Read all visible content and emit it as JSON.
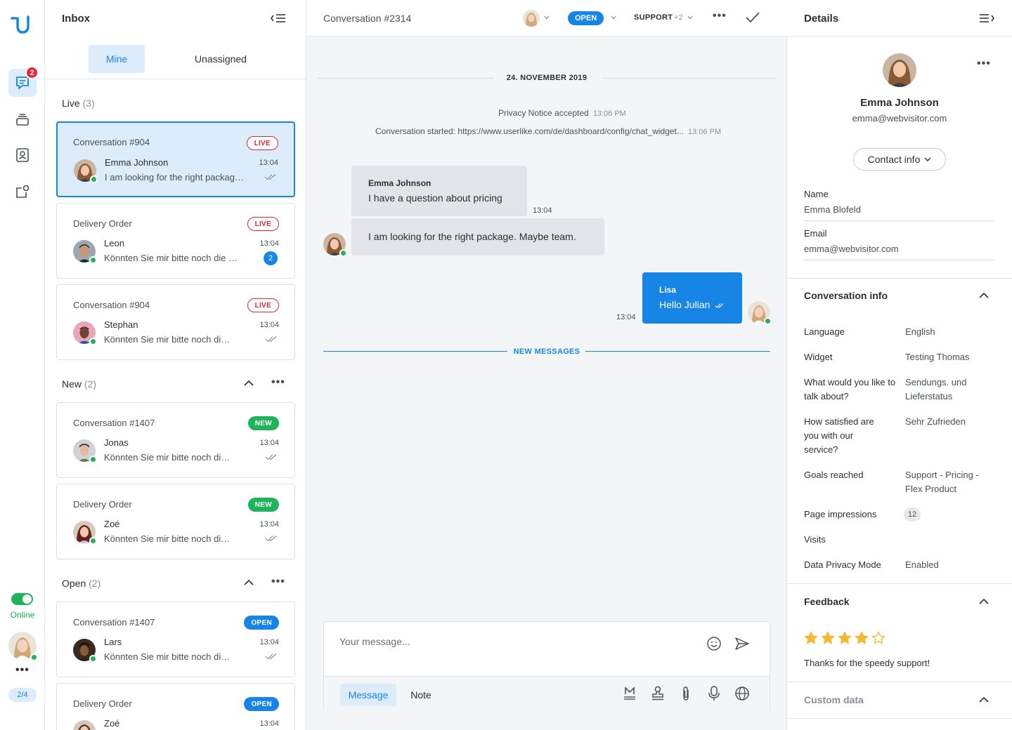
{
  "colors": {
    "accent": "#1785e6",
    "accent_light": "#dcecfb",
    "live": "#e52833",
    "success": "#1fb35b",
    "star": "#f5b82e"
  },
  "rail": {
    "logo": "userlike-logo",
    "items": [
      {
        "icon": "chat-icon",
        "active": true,
        "badge": "2"
      },
      {
        "icon": "stack-icon"
      },
      {
        "icon": "contacts-icon"
      },
      {
        "icon": "widget-icon"
      }
    ],
    "status": "Online",
    "page_indicator": "2/4"
  },
  "inbox": {
    "title": "Inbox",
    "tabs": {
      "mine": "Mine",
      "unassigned": "Unassigned"
    },
    "sections": {
      "live": {
        "label": "Live",
        "count": "(3)"
      },
      "new": {
        "label": "New",
        "count": "(2)"
      },
      "open": {
        "label": "Open",
        "count": "(2)"
      }
    },
    "cards": [
      {
        "title": "Conversation #904",
        "status": "LIVE",
        "name": "Emma Johnson",
        "message": "I am looking for the right package. Maybe team.",
        "time": "13:04"
      },
      {
        "title": "Delivery Order",
        "status": "LIVE",
        "name": "Leon",
        "message": "Könnten Sie mir bitte noch die Lieferzeit sagen?",
        "time": "13:04",
        "unread": "2"
      },
      {
        "title": "Conversation #904",
        "status": "LIVE",
        "name": "Stephan",
        "message": "Könnten Sie mir bitte noch die Lieferzeit sagen?",
        "time": "13:04"
      },
      {
        "title": "Conversation #1407",
        "status": "NEW",
        "name": "Jonas",
        "message": "Könnten Sie mir bitte noch die Lieferzeit sagen?",
        "time": "13:04"
      },
      {
        "title": "Delivery Order",
        "status": "NEW",
        "name": "Zoé",
        "message": "Könnten Sie mir bitte noch die Lieferzeit sagen?",
        "time": "13:04"
      },
      {
        "title": "Conversation #1407",
        "status": "OPEN",
        "name": "Lars",
        "message": "Könnten Sie mir bitte noch die Lieferzeit sagen?",
        "time": "13:04"
      },
      {
        "title": "Delivery Order",
        "status": "OPEN",
        "name": "Zoé",
        "message": "",
        "time": "13:04"
      }
    ]
  },
  "conversation": {
    "title": "Conversation #2314",
    "status": "OPEN",
    "team": "SUPPORT",
    "team_extra": "+2",
    "date": "24. NOVEMBER 2019",
    "system": [
      {
        "text": "Privacy Notice accepted",
        "time": "13:06 PM"
      },
      {
        "text": "Conversation started: https://www.userlike.com/de/dashboard/config/chat_widget...",
        "time": "13:06 PM"
      }
    ],
    "messages": [
      {
        "sender": "Emma Johnson",
        "text": "I have a question about pricing",
        "time": "13:04"
      },
      {
        "text": "I am looking for the right package. Maybe team."
      },
      {
        "sender": "Lisa",
        "text": "Hello Julian",
        "time": "13:04"
      }
    ],
    "new_messages": "NEW MESSAGES",
    "composer": {
      "placeholder": "Your message...",
      "tab_message": "Message",
      "tab_note": "Note"
    }
  },
  "details": {
    "title": "Details",
    "profile": {
      "name": "Emma Johnson",
      "email": "emma@webvisitor.com"
    },
    "contact_button": "Contact info",
    "fields": [
      {
        "label": "Name",
        "value": "Emma Blofeld"
      },
      {
        "label": "Email",
        "value": "emma@webvisitor.com"
      }
    ],
    "conversation_info": {
      "title": "Conversation info",
      "rows": [
        {
          "label": "Language",
          "value": "English"
        },
        {
          "label": "Widget",
          "value": "Testing Thomas"
        },
        {
          "label": "What would you like to talk about?",
          "value": "Sendungs. und Lieferstatus"
        },
        {
          "label": "How satisfied are you with our service?",
          "value": "Sehr Zufrieden"
        },
        {
          "label": "Goals reached",
          "value": "Support - Pricing - Flex Product"
        },
        {
          "label": "Page impressions",
          "value": "12"
        },
        {
          "label": "Visits",
          "value": ""
        },
        {
          "label": "Data Privacy Mode",
          "value": "Enabled"
        }
      ]
    },
    "feedback": {
      "title": "Feedback",
      "rating": 4,
      "max": 5,
      "text": "Thanks for the speedy support!"
    },
    "custom_data": {
      "title": "Custom data"
    }
  }
}
